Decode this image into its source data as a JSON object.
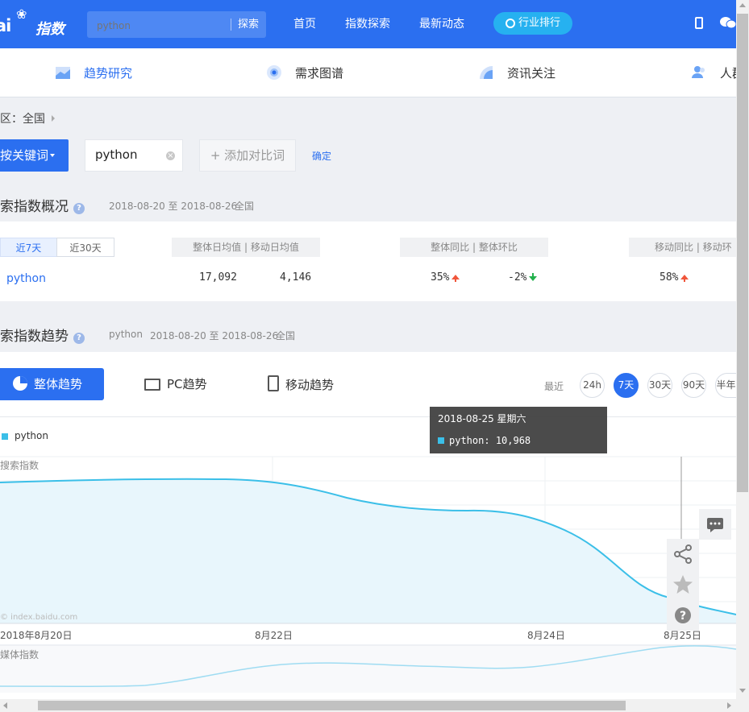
{
  "header": {
    "logo_text": "ai",
    "logo_cn": "指数",
    "search_placeholder": "python",
    "search_button": "探索",
    "nav": [
      "首页",
      "指数探索",
      "最新动态"
    ],
    "rank_button": "行业排行"
  },
  "tabs": [
    "趋势研究",
    "需求图谱",
    "资讯关注",
    "人群"
  ],
  "region": {
    "label": "区：全国"
  },
  "keyword_bar": {
    "mode_label": "按关键词",
    "keyword": "python",
    "add_compare": "+ 添加对比词",
    "confirm": "确定"
  },
  "overview": {
    "title": "索指数概况",
    "date_range": "2018-08-20 至 2018-08-26",
    "region": "全国",
    "periods": [
      "近7天",
      "近30天"
    ],
    "headers": [
      "整体日均值  |  移动日均值",
      "整体同比  |  整体环比",
      "移动同比  |  移动环"
    ],
    "row": {
      "keyword": "python",
      "overall_daily_avg": "17,092",
      "mobile_daily_avg": "4,146",
      "overall_yoy": "35%",
      "overall_mom": "-2%",
      "mobile_yoy": "58%"
    }
  },
  "trend": {
    "title": "索指数趋势",
    "keyword": "python",
    "date_range": "2018-08-20 至 2018-08-26",
    "region": "全国",
    "tabs": {
      "overall": "整体趋势",
      "pc": "PC趋势",
      "mobile": "移动趋势"
    },
    "range_label": "最近",
    "ranges": [
      "24h",
      "7天",
      "30天",
      "90天",
      "半年"
    ],
    "active_range": "7天",
    "legend": "python",
    "y_title": "搜索指数",
    "watermark": "© index.baidu.com",
    "x_ticks": [
      "2018年8月20日",
      "8月22日",
      "8月24日",
      "8月25日"
    ],
    "mini_title": "媒体指数",
    "tooltip": {
      "date": "2018-08-25 星期六",
      "series": "python",
      "value": "10,968"
    }
  },
  "colors": {
    "brand": "#2b6ff0",
    "series": "#3bbfe8",
    "area": "#e8f6fc",
    "up": "#f0553a",
    "down": "#22b14c"
  },
  "icons": [
    "search-icon",
    "phone-icon",
    "wechat-icon",
    "chart-tab-icon",
    "target-icon",
    "news-icon",
    "user-icon",
    "pie-icon",
    "monitor-icon",
    "mobile-icon",
    "comment-icon",
    "share-icon",
    "star-icon",
    "help-icon"
  ]
}
